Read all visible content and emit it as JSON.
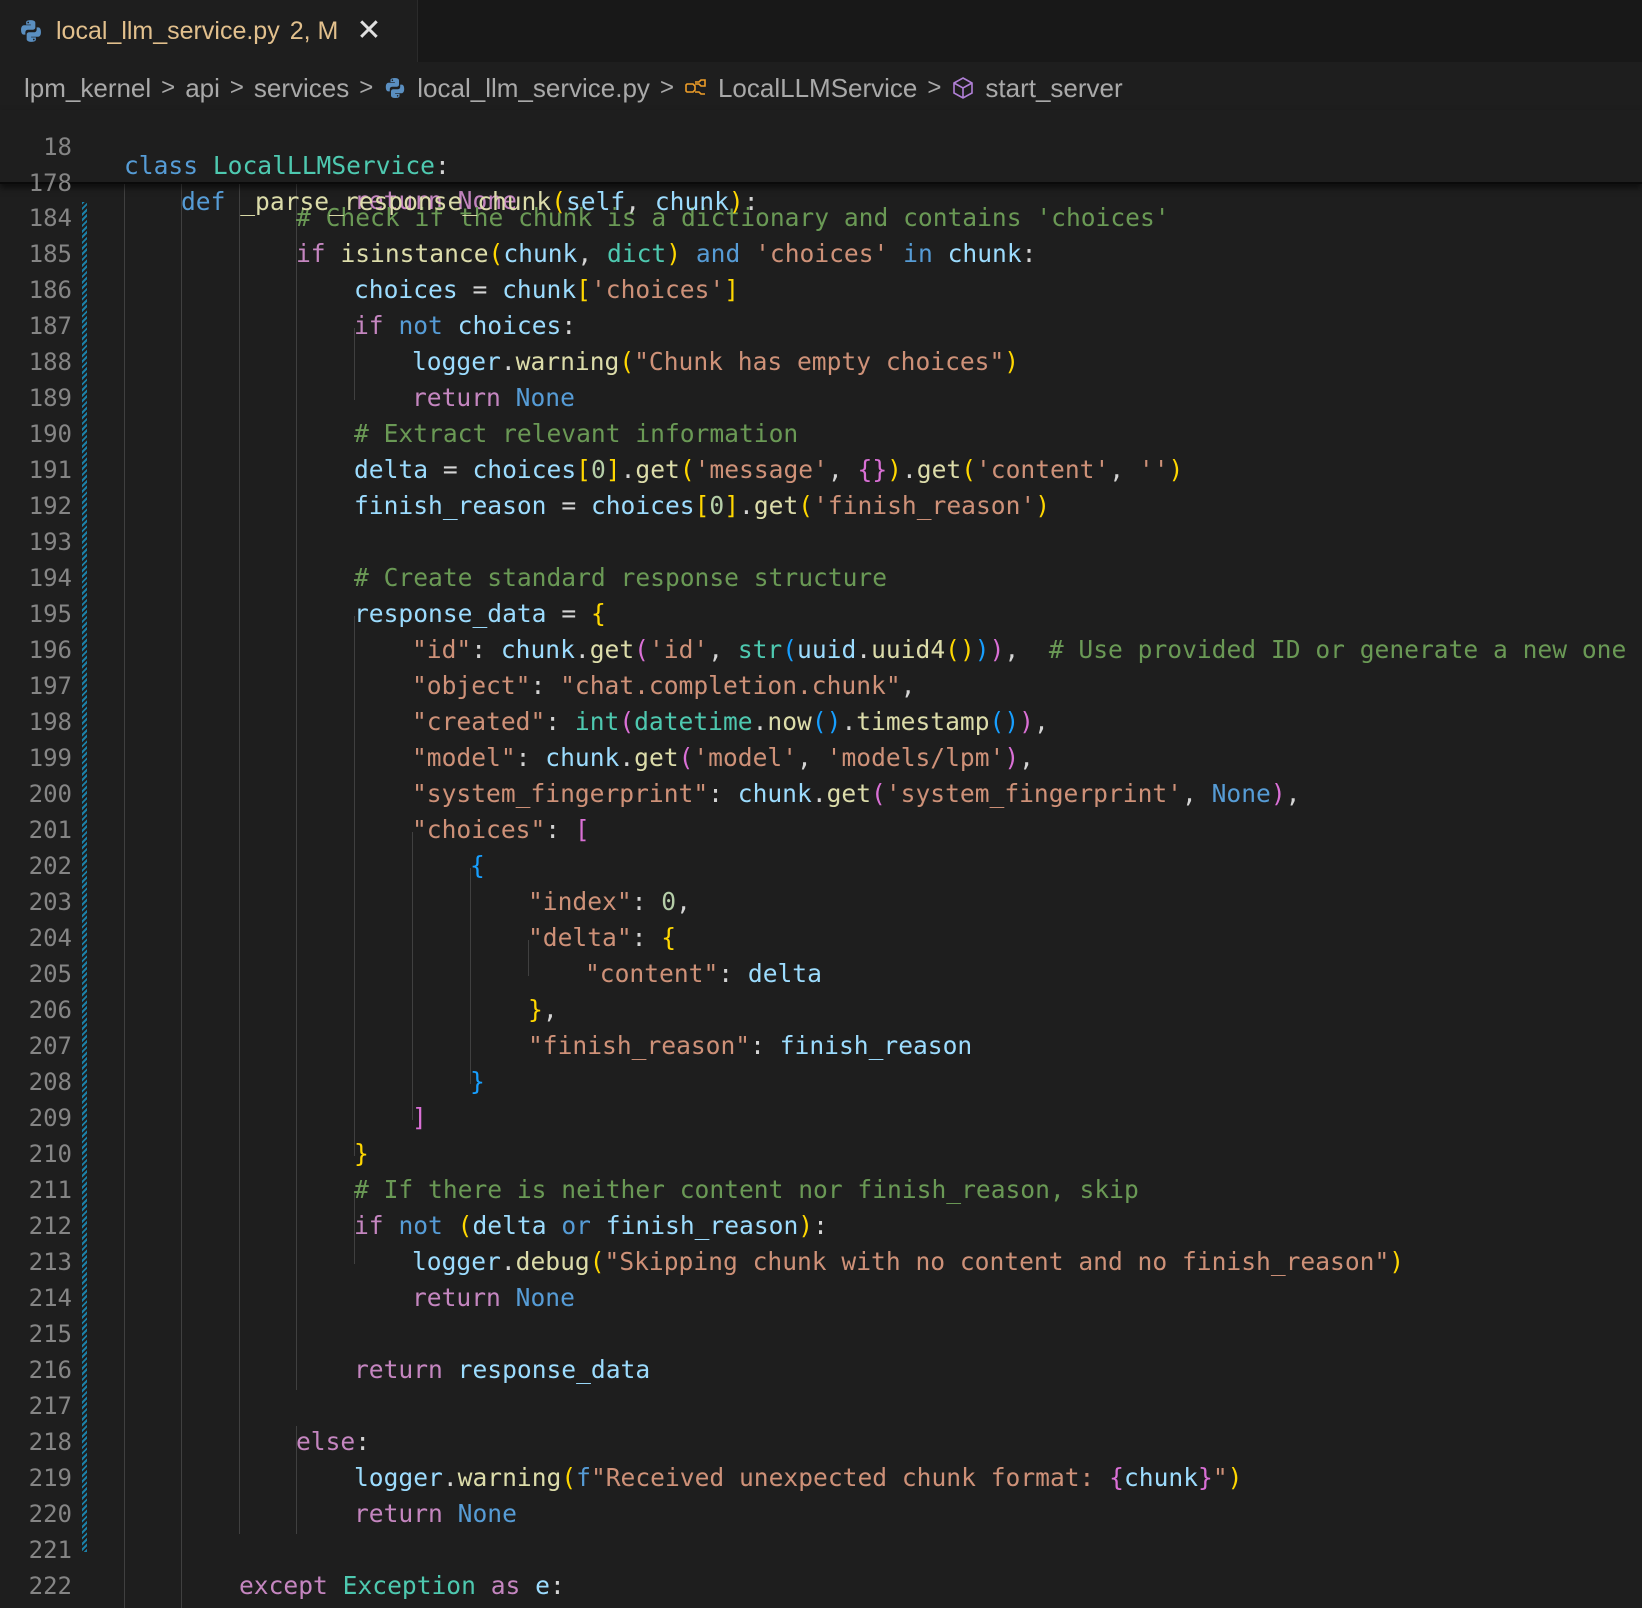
{
  "tab": {
    "icon": "python-file-icon",
    "title": "local_llm_service.py",
    "badge": "2, M",
    "close": "✕"
  },
  "breadcrumb": {
    "items": [
      "lpm_kernel",
      "api",
      "services",
      "local_llm_service.py",
      "LocalLLMService",
      "start_server"
    ],
    "separator": ">"
  },
  "sticky": [
    {
      "n": "18",
      "code": "class LocalLLMService:"
    },
    {
      "n": "178",
      "code": "def _parse_response_chunk(self, chunk):"
    }
  ],
  "partial_line": "return None",
  "lines": [
    {
      "n": "184",
      "code": "# Check if the chunk is a dictionary and contains 'choices'"
    },
    {
      "n": "185",
      "code": "if isinstance(chunk, dict) and 'choices' in chunk:"
    },
    {
      "n": "186",
      "code": "choices = chunk['choices']"
    },
    {
      "n": "187",
      "code": "if not choices:"
    },
    {
      "n": "188",
      "code": "logger.warning(\"Chunk has empty choices\")"
    },
    {
      "n": "189",
      "code": "return None"
    },
    {
      "n": "190",
      "code": "# Extract relevant information"
    },
    {
      "n": "191",
      "code": "delta = choices[0].get('message', {}).get('content', '')"
    },
    {
      "n": "192",
      "code": "finish_reason = choices[0].get('finish_reason')"
    },
    {
      "n": "193",
      "code": ""
    },
    {
      "n": "194",
      "code": "# Create standard response structure"
    },
    {
      "n": "195",
      "code": "response_data = {"
    },
    {
      "n": "196",
      "code": "\"id\": chunk.get('id', str(uuid.uuid4())),  # Use provided ID or generate a new one"
    },
    {
      "n": "197",
      "code": "\"object\": \"chat.completion.chunk\","
    },
    {
      "n": "198",
      "code": "\"created\": int(datetime.now().timestamp()),"
    },
    {
      "n": "199",
      "code": "\"model\": chunk.get('model', 'models/lpm'),"
    },
    {
      "n": "200",
      "code": "\"system_fingerprint\": chunk.get('system_fingerprint', None),"
    },
    {
      "n": "201",
      "code": "\"choices\": ["
    },
    {
      "n": "202",
      "code": "{"
    },
    {
      "n": "203",
      "code": "\"index\": 0,"
    },
    {
      "n": "204",
      "code": "\"delta\": {"
    },
    {
      "n": "205",
      "code": "\"content\": delta"
    },
    {
      "n": "206",
      "code": "},"
    },
    {
      "n": "207",
      "code": "\"finish_reason\": finish_reason"
    },
    {
      "n": "208",
      "code": "}"
    },
    {
      "n": "209",
      "code": "]"
    },
    {
      "n": "210",
      "code": "}"
    },
    {
      "n": "211",
      "code": "# If there is neither content nor finish_reason, skip"
    },
    {
      "n": "212",
      "code": "if not (delta or finish_reason):"
    },
    {
      "n": "213",
      "code": "logger.debug(\"Skipping chunk with no content and no finish_reason\")"
    },
    {
      "n": "214",
      "code": "return None"
    },
    {
      "n": "215",
      "code": ""
    },
    {
      "n": "216",
      "code": "return response_data"
    },
    {
      "n": "217",
      "code": ""
    },
    {
      "n": "218",
      "code": "else:"
    },
    {
      "n": "219",
      "code": "logger.warning(f\"Received unexpected chunk format: {chunk}\")"
    },
    {
      "n": "220",
      "code": "return None"
    },
    {
      "n": "221",
      "code": ""
    },
    {
      "n": "222",
      "code": "except Exception as e:"
    }
  ],
  "colors": {
    "background": "#1e1e1e",
    "keyword": "#569cd6",
    "control": "#c586c0",
    "string": "#ce9178",
    "comment": "#6a9955",
    "function": "#dcdcaa",
    "variable": "#9cdcfe",
    "type": "#4ec9b0",
    "modified_tab": "#e2c08d",
    "git_modified_bar": "#1b81a8"
  }
}
